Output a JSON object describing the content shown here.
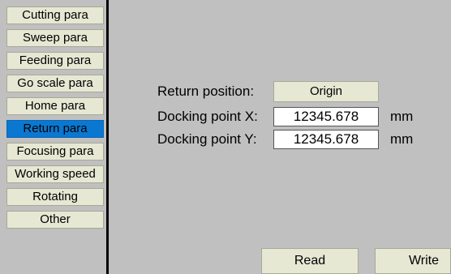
{
  "sidebar": {
    "items": [
      {
        "label": "Cutting para"
      },
      {
        "label": "Sweep para"
      },
      {
        "label": "Feeding para"
      },
      {
        "label": "Go scale para"
      },
      {
        "label": "Home para"
      },
      {
        "label": "Return para",
        "active": true
      },
      {
        "label": "Focusing para"
      },
      {
        "label": "Working speed"
      },
      {
        "label": "Rotating"
      },
      {
        "label": "Other"
      }
    ]
  },
  "form": {
    "return_position": {
      "label": "Return position:",
      "value": "Origin"
    },
    "docking_x": {
      "label": "Docking point X:",
      "value": "12345.678",
      "unit": "mm"
    },
    "docking_y": {
      "label": "Docking point Y:",
      "value": "12345.678",
      "unit": "mm"
    }
  },
  "buttons": {
    "read": "Read",
    "write": "Write"
  },
  "colors": {
    "background": "#c0c0c0",
    "button_face": "#e6e8d3",
    "active_item": "#0a78d0",
    "divider": "#000000",
    "field_background": "#ffffff"
  }
}
